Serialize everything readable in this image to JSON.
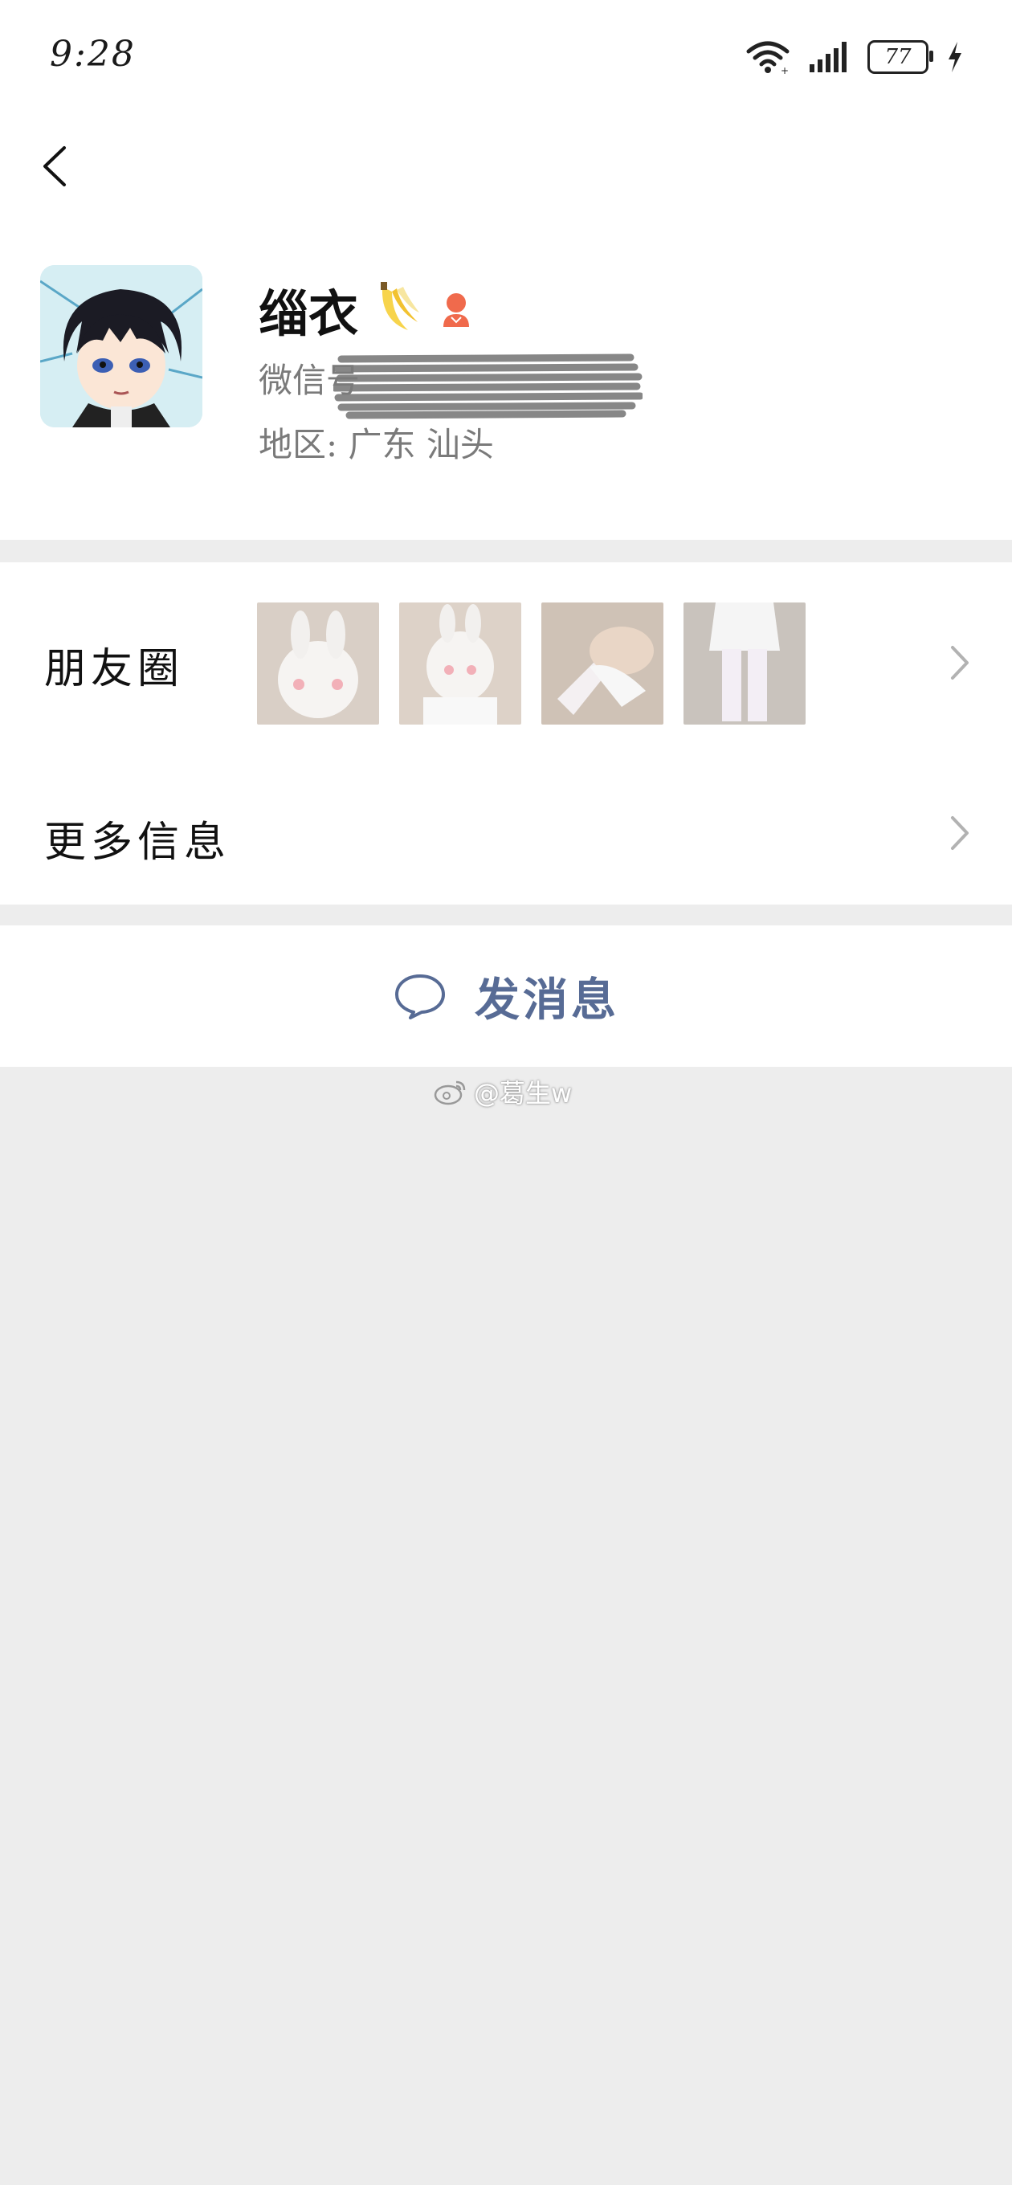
{
  "status_bar": {
    "time": "9:28",
    "battery": "77"
  },
  "profile": {
    "nickname": "缁衣",
    "wechat_id_label": "微信号",
    "region_label": "地区:",
    "region_value": "广东 汕头"
  },
  "rows": {
    "moments_label": "朋友圈",
    "more_info_label": "更多信息"
  },
  "actions": {
    "send_message_label": "发消息"
  },
  "watermark": {
    "text": "@葛生w"
  },
  "colors": {
    "link_blue": "#576b95",
    "background": "#ededed",
    "gender_icon": "#f06a4c"
  },
  "icons": [
    "back-arrow-icon",
    "wifi-icon",
    "signal-icon",
    "battery-icon",
    "charging-icon",
    "banana-icon",
    "female-icon",
    "chevron-right-icon",
    "chat-bubble-icon",
    "weibo-icon"
  ]
}
